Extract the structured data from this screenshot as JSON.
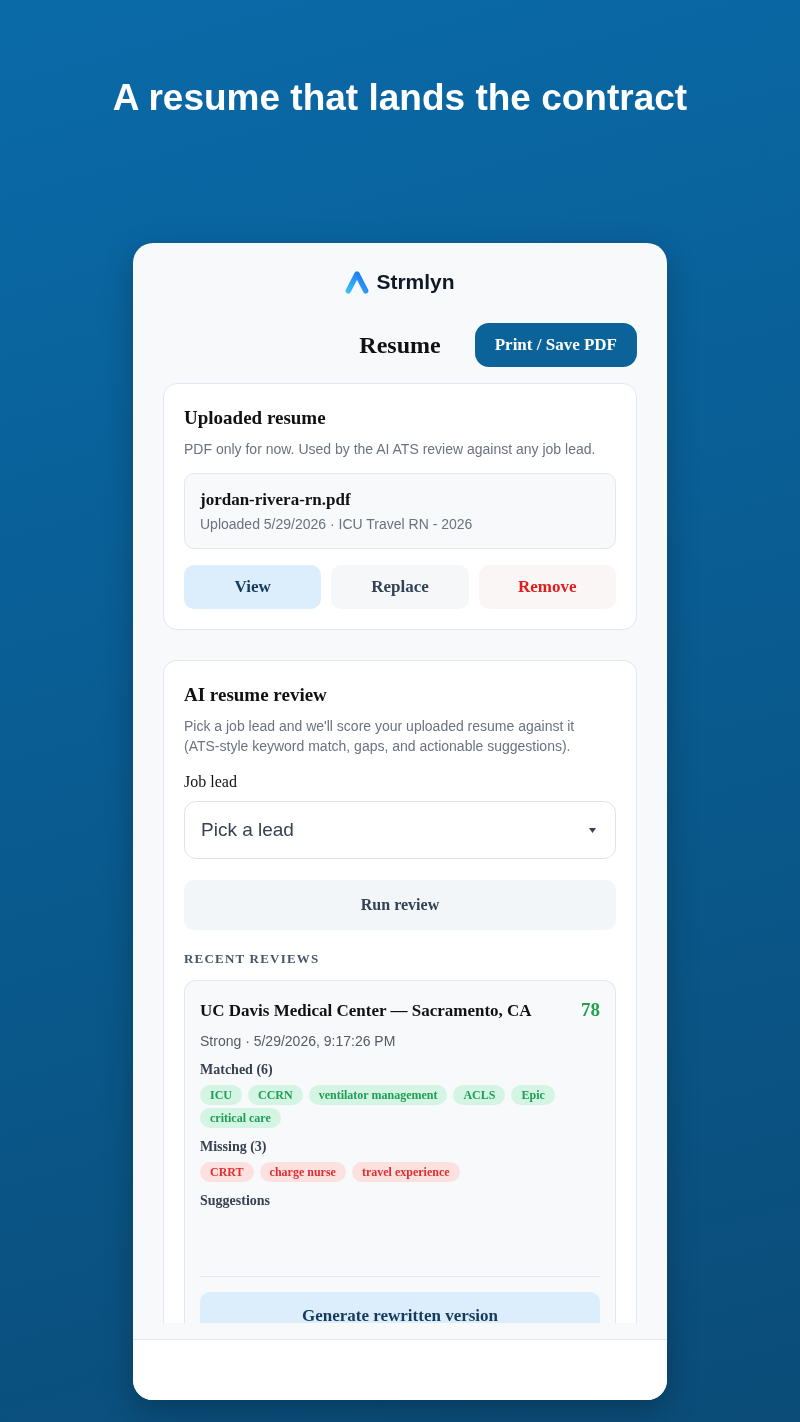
{
  "headline": "A resume that lands the contract",
  "brand": {
    "name": "Strmlyn"
  },
  "header": {
    "title": "Resume",
    "action": "Print / Save PDF"
  },
  "uploaded_resume": {
    "title": "Uploaded resume",
    "description": "PDF only for now. Used by the AI ATS review against any job lead.",
    "file": {
      "name": "jordan-rivera-rn.pdf",
      "meta": "Uploaded 5/29/2026 · ICU Travel RN - 2026"
    },
    "actions": [
      {
        "label": "View",
        "kind": "primary"
      },
      {
        "label": "Replace",
        "kind": "secondary"
      },
      {
        "label": "Remove",
        "kind": "danger"
      }
    ]
  },
  "ai_review": {
    "title": "AI resume review",
    "description": "Pick a job lead and we'll score your uploaded resume against it (ATS-style keyword match, gaps, and actionable suggestions).",
    "job_lead": {
      "label": "Job lead",
      "value": "Pick a lead"
    },
    "run_button": "Run review",
    "recent_heading": "RECENT REVIEWS",
    "reviews": [
      {
        "title": "UC Davis Medical Center — Sacramento, CA",
        "score": "78",
        "meta": "Strong · 5/29/2026, 9:17:26 PM",
        "keyword_groups": [
          {
            "kind": "matched",
            "label": "Matched (6)",
            "keywords": [
              "ICU",
              "CCRN",
              "ventilator management",
              "ACLS",
              "Epic",
              "critical care"
            ]
          },
          {
            "kind": "missing",
            "label": "Missing (3)",
            "keywords": [
              "CRRT",
              "charge nurse",
              "travel experience"
            ]
          }
        ],
        "suggestions_label": "Suggestions",
        "rewrite_button": "Generate rewritten version"
      }
    ]
  }
}
